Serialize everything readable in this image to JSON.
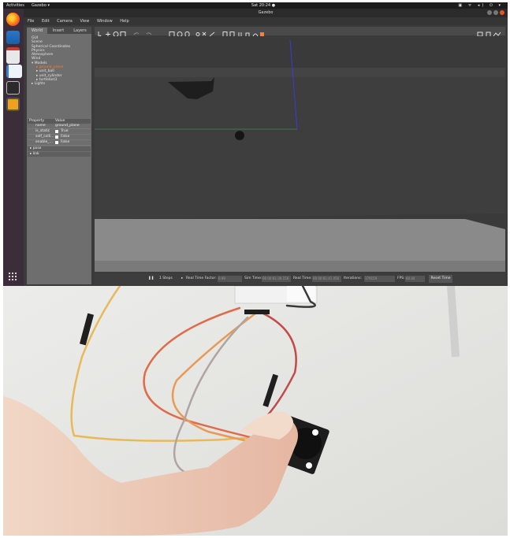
{
  "topbar": {
    "activities": "Activities",
    "app_menu": "Gazebo ▾",
    "clock": "Sat 20:24 ●",
    "tray": "▣ ᯤ ◂) ⏻ ▾"
  },
  "window": {
    "title": "Gazebo",
    "menu": [
      "File",
      "Edit",
      "Camera",
      "View",
      "Window",
      "Help"
    ]
  },
  "left_panel": {
    "tabs": [
      "World",
      "Insert",
      "Layers"
    ],
    "tree": {
      "items": [
        "GUI",
        "Scene",
        "Spherical Coordinates",
        "Physics",
        "Atmosphere",
        "Wind",
        "Models"
      ],
      "models": [
        "ground_plane",
        "unit_ball",
        "unit_cylinder",
        "turtlebot3"
      ],
      "lights": "Lights"
    },
    "properties": {
      "header_property": "Property",
      "header_value": "Value",
      "rows": [
        {
          "key": "name",
          "value": "ground_plane"
        },
        {
          "key": "is_static",
          "value": "True"
        },
        {
          "key": "self_colli...",
          "value": "False"
        },
        {
          "key": "enable_...",
          "value": "False"
        }
      ],
      "groups": [
        "pose",
        "link"
      ]
    }
  },
  "bottom_bar": {
    "steps": "1 Steps",
    "rtf_label": "Real Time Factor:",
    "rtf_value": "0.99",
    "sim_label": "Sim Time:",
    "sim_value": "00 00:01:39.156",
    "real_label": "Real Time:",
    "real_value": "00 00:01:41.056",
    "iter_label": "Iterations:",
    "iter_value": "179159",
    "fps_label": "FPS:",
    "fps_value": "60.44",
    "reset_label": "Reset Time"
  },
  "colors": {
    "dock": "#3c2d3a",
    "selected_model": "#ff7a2a",
    "sky": "#3a3a3a",
    "ground": "#8c8c8c"
  },
  "icons": [
    "firefox-icon",
    "files-icon",
    "notes-icon",
    "text-editor-icon",
    "terminal-icon",
    "gazebo-icon",
    "apps-grid-icon"
  ]
}
